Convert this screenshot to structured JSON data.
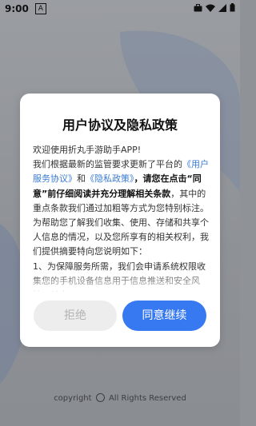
{
  "status_bar": {
    "time": "9:00",
    "app_icon": "A"
  },
  "dialog": {
    "title": "用户协议及隐私政策",
    "paragraphs": {
      "p1": "欢迎使用折丸手游助手APP!",
      "p2_a": "我们根据最新的监管要求更新了平台的",
      "p2_link1": "《用户服务协议》",
      "p2_and": "和",
      "p2_link2": "《隐私政策》",
      "p2_b": "，请您在点击“同意”前仔细阅读并充分理解相关条款",
      "p2_c": "，其中的重点条款我们通过加粗等方式为您特别标注。为帮助您了解我们收集、使用、存储和共享个人信息的情况，以及您所享有的相关权利，我们提供摘要特向您说明如下：",
      "p3": "1、为保障服务所需，我们会申请系统权限收集您的手机设备信息用于信息推送和安全风控，并申"
    },
    "decline_label": "拒绝",
    "accept_label": "同意继续"
  },
  "footer": {
    "copyright_prefix": "copyright",
    "copyright_suffix": "All Rights Reserved"
  },
  "colors": {
    "accent": "#3779f0",
    "link": "#3a7bd5",
    "decline_bg": "#ededed"
  }
}
